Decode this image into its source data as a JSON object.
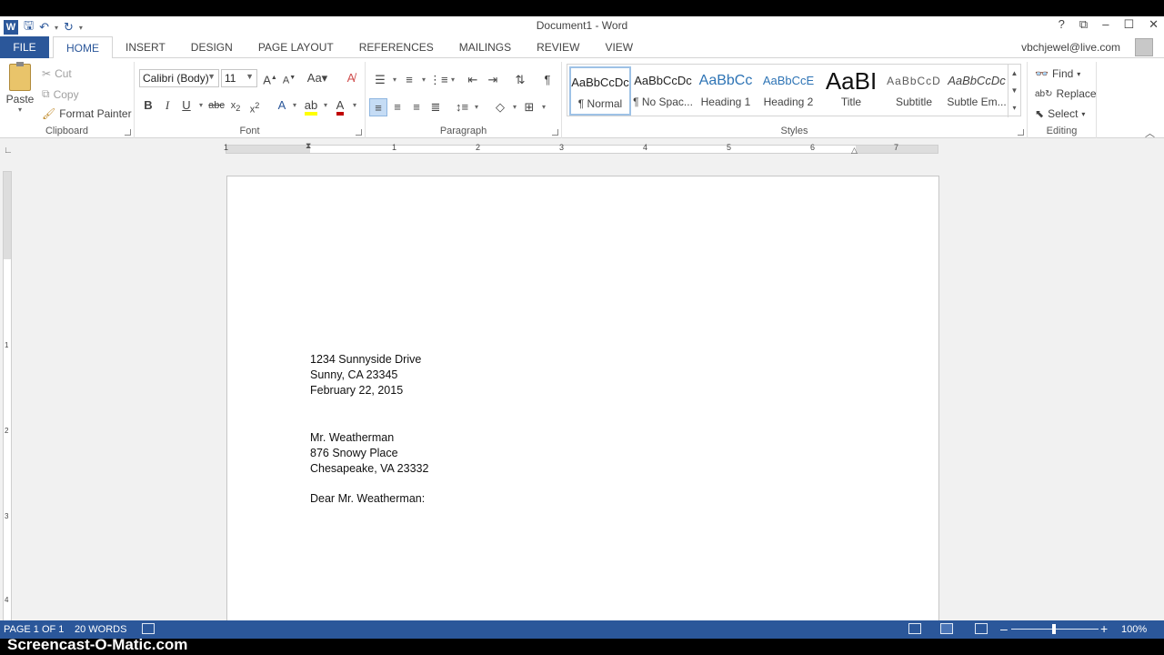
{
  "window": {
    "title": "Document1 - Word",
    "account": "vbchjewel@live.com",
    "controls": [
      "?",
      "⧉",
      "–",
      "☐",
      "✕"
    ]
  },
  "tabs": {
    "file": "FILE",
    "items": [
      "HOME",
      "INSERT",
      "DESIGN",
      "PAGE LAYOUT",
      "REFERENCES",
      "MAILINGS",
      "REVIEW",
      "VIEW"
    ],
    "active": "HOME"
  },
  "clipboard": {
    "paste": "Paste",
    "cut": "Cut",
    "copy": "Copy",
    "format_painter": "Format Painter",
    "label": "Clipboard"
  },
  "font": {
    "name": "Calibri (Body)",
    "size": "11",
    "label": "Font",
    "font_color": "#c00000",
    "highlight_color": "#ffff00"
  },
  "paragraph": {
    "label": "Paragraph"
  },
  "styles": {
    "label": "Styles",
    "items": [
      {
        "preview": "AaBbCcDc",
        "name": "¶ Normal"
      },
      {
        "preview": "AaBbCcDc",
        "name": "¶ No Spac..."
      },
      {
        "preview": "AaBbCc",
        "name": "Heading 1"
      },
      {
        "preview": "AaBbCcE",
        "name": "Heading 2"
      },
      {
        "preview": "AaBI",
        "name": "Title"
      },
      {
        "preview": "AaBbCcD",
        "name": "Subtitle"
      },
      {
        "preview": "AaBbCcDc",
        "name": "Subtle Em..."
      }
    ]
  },
  "editing": {
    "find": "Find",
    "replace": "Replace",
    "select": "Select",
    "label": "Editing"
  },
  "ruler": {
    "h_numbers": [
      "1",
      "1",
      "2",
      "3",
      "4",
      "5",
      "6",
      "7"
    ],
    "v_numbers": [
      "1",
      "2",
      "3",
      "4"
    ]
  },
  "document": {
    "sender": [
      "1234 Sunnyside Drive",
      "Sunny, CA 23345",
      "February 22, 2015"
    ],
    "recipient": [
      "Mr. Weatherman",
      "876 Snowy Place",
      "Chesapeake, VA 23332"
    ],
    "salutation": "Dear Mr. Weatherman:"
  },
  "status": {
    "page": "PAGE 1 OF 1",
    "words": "20 WORDS",
    "zoom": "100%",
    "zoom_minus": "–",
    "zoom_plus": "+"
  },
  "watermark": "Screencast-O-Matic.com",
  "colors": {
    "accent": "#2b579a"
  }
}
